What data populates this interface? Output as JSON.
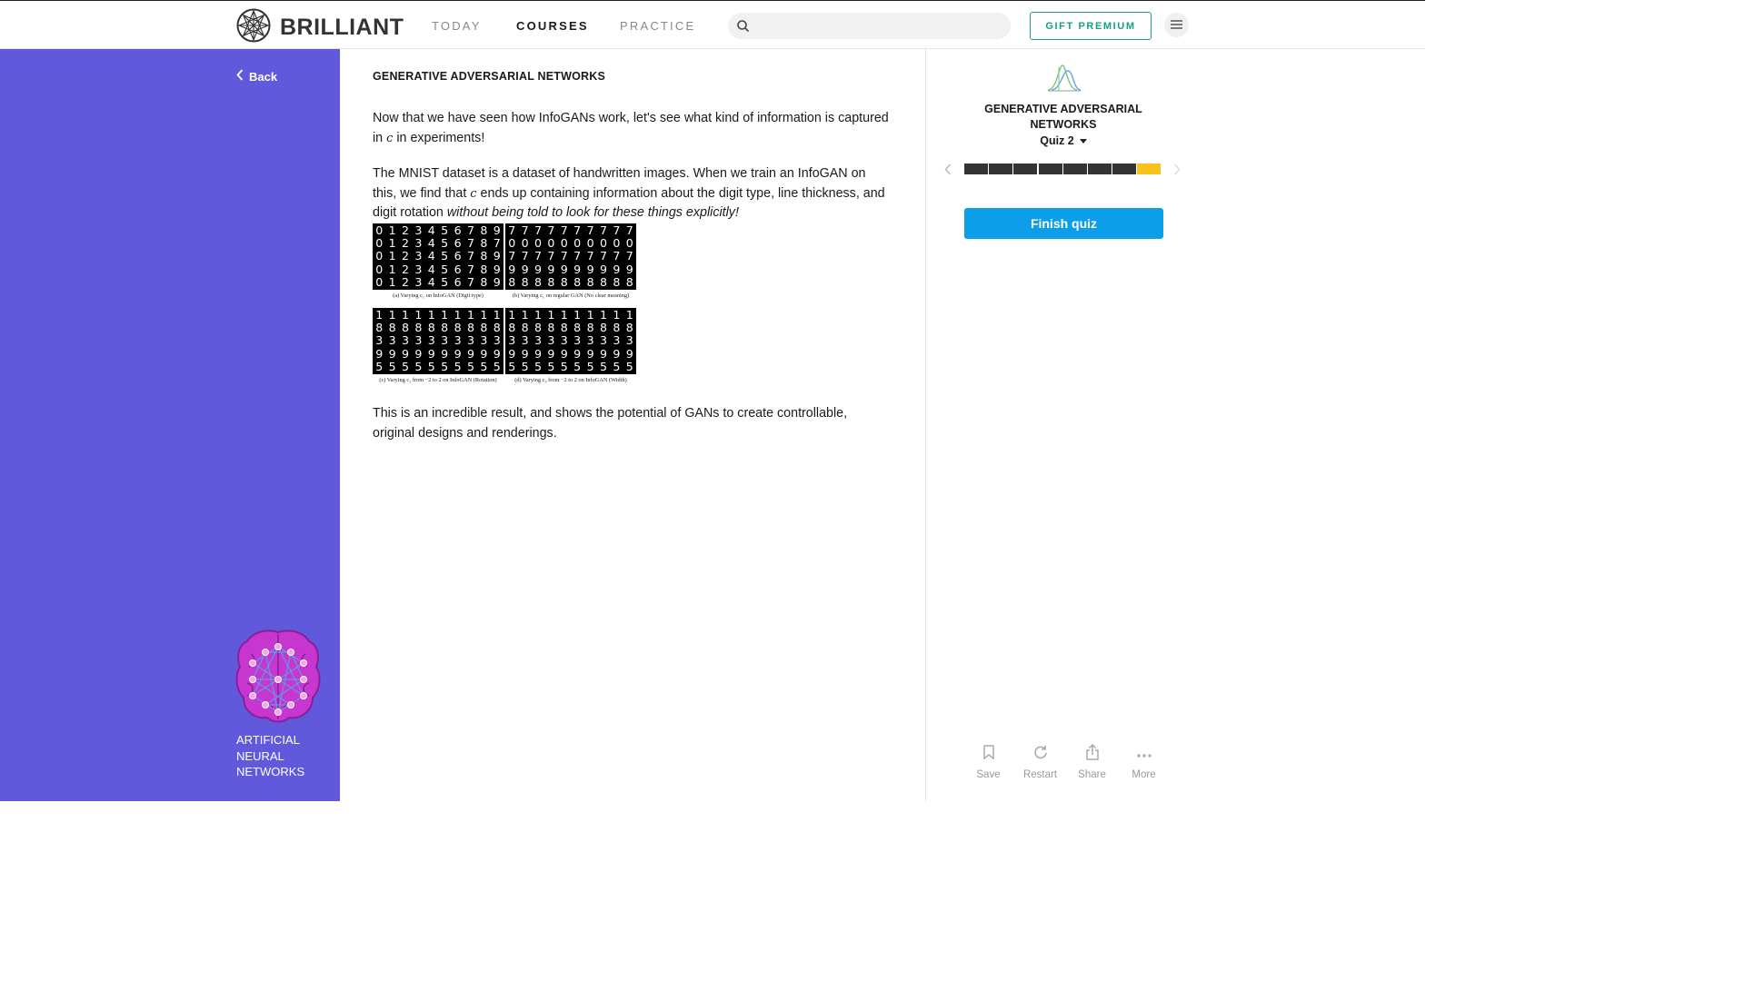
{
  "header": {
    "logo_text": "BRILLIANT",
    "nav": [
      {
        "label": "TODAY",
        "active": false
      },
      {
        "label": "COURSES",
        "active": true
      },
      {
        "label": "PRACTICE",
        "active": false
      }
    ],
    "search_placeholder": "",
    "gift_label": "GIFT PREMIUM",
    "icons": {
      "logo": "brilliant-logo-icon",
      "search": "search-icon",
      "menu": "hamburger-menu-icon"
    }
  },
  "sidebar": {
    "back_label": "Back",
    "course_title": "ARTIFICIAL NEURAL NETWORKS",
    "background_color": "#6059dc",
    "icons": {
      "back": "chevron-left-icon",
      "course": "brain-network-icon"
    }
  },
  "main": {
    "kicker": "GENERATIVE ADVERSARIAL NETWORKS",
    "para1": {
      "before": "Now that we have seen how InfoGANs work, let's see what kind of information is captured in ",
      "var": "c",
      "after": " in experiments!"
    },
    "para2": {
      "before": "The MNIST dataset is a dataset of handwritten images. When we train an InfoGAN on this, we find that ",
      "var": "c",
      "after": " ends up containing information about the digit type, line thickness, and digit rotation ",
      "emphasis": "without being told to look for these things explicitly!"
    },
    "para3": "This is an incredible result, and shows the potential of GANs to create controllable, original designs and renderings.",
    "figure": {
      "panels": [
        {
          "rows": [
            "0123456789",
            "0123456787",
            "0123456789",
            "0123456789",
            "0123456789"
          ],
          "caption": "(a) Varying c₁ on InfoGAN (Digit type)"
        },
        {
          "rows": [
            "7777777777",
            "0000000000",
            "7777777777",
            "9999999999",
            "8888888888"
          ],
          "caption": "(b) Varying c₁ on regular GAN (No clear meaning)"
        },
        {
          "rows": [
            "1111111111",
            "8888888888",
            "3333333333",
            "9999999999",
            "5555555555"
          ],
          "caption": "(c) Varying c₂ from −2 to 2 on InfoGAN (Rotation)"
        },
        {
          "rows": [
            "1111111111",
            "8888888888",
            "3333333333",
            "9999999999",
            "5555555555"
          ],
          "caption": "(d) Varying c₃ from −2 to 2 on InfoGAN (Width)"
        }
      ]
    }
  },
  "right_panel": {
    "chapter_title": "GENERATIVE ADVERSARIAL NETWORKS",
    "quiz_label": "Quiz 2",
    "progress": {
      "total": 8,
      "completed": 7,
      "current_index": 7
    },
    "progress_colors": {
      "done": "#333333",
      "current": "#f8c11b"
    },
    "finish_label": "Finish quiz",
    "finish_color": "#0c9ee8",
    "actions": [
      {
        "label": "Save",
        "icon": "bookmark-icon"
      },
      {
        "label": "Restart",
        "icon": "restart-icon"
      },
      {
        "label": "Share",
        "icon": "share-icon"
      },
      {
        "label": "More",
        "icon": "more-dots-icon"
      }
    ]
  }
}
